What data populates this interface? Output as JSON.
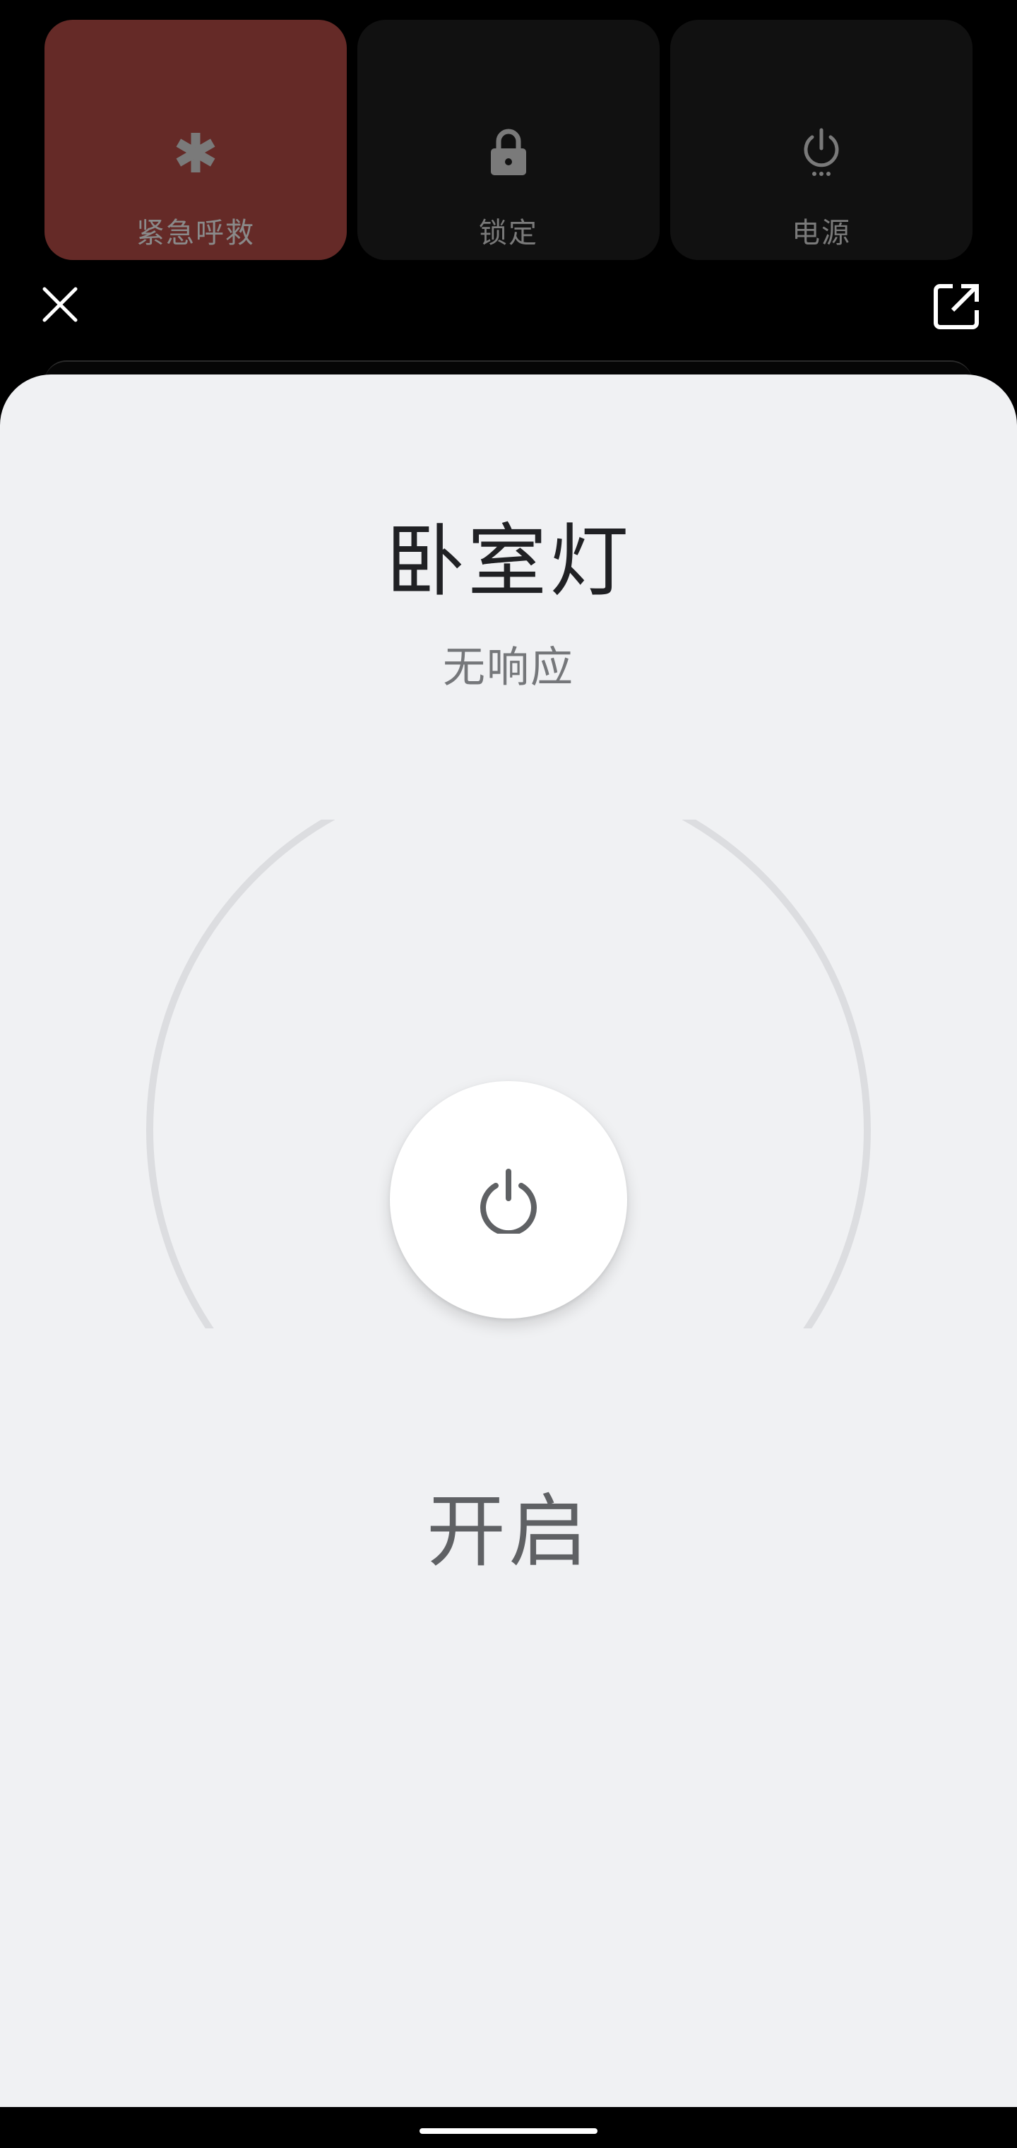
{
  "power_menu": {
    "tiles": [
      {
        "label": "紧急呼救",
        "icon": "asterisk-icon"
      },
      {
        "label": "锁定",
        "icon": "lock-icon"
      },
      {
        "label": "电源",
        "icon": "power-icon"
      }
    ],
    "emergency_color": "#652a27",
    "tile_color": "#111111"
  },
  "toolbar": {
    "close_icon": "close-icon",
    "open_icon": "open-external-icon"
  },
  "device": {
    "title": "卧室灯",
    "status": "无响应",
    "state_label": "开启",
    "power_icon": "power-icon"
  },
  "colors": {
    "sheet_background": "#f0f1f3",
    "dial_track": "#dcdde0",
    "title_text": "#202124",
    "secondary_text": "#75777a"
  }
}
